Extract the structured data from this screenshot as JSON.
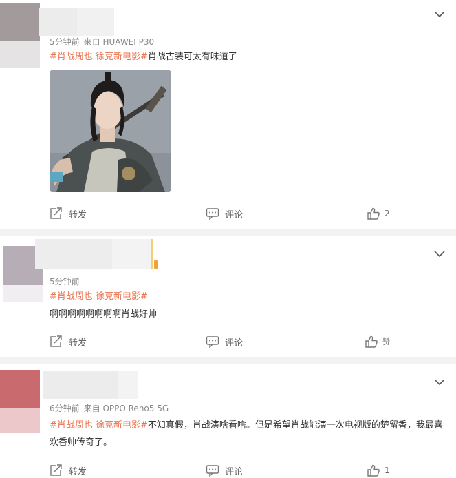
{
  "posts": [
    {
      "time": "5分钟前",
      "source": "来自 HUAWEI P30",
      "topics": "#肖战周也 徐克新电影#",
      "text": "肖战古装可太有味道了",
      "has_photo": true,
      "actions": {
        "repost": "转发",
        "comment": "评论",
        "like": "2"
      }
    },
    {
      "time": "5分钟前",
      "source": "",
      "topics": "#肖战周也 徐克新电影#",
      "text": "啊啊啊啊啊啊啊啊肖战好帅",
      "actions": {
        "repost": "转发",
        "comment": "评论",
        "like": "赞"
      }
    },
    {
      "time": "6分钟前",
      "source": "来自 OPPO Reno5 5G",
      "topics": "#肖战周也 徐克新电影#",
      "text": "不知真假，肖战演啥看啥。但是希望肖战能演一次电视版的楚留香，我最喜欢香帅传奇了。",
      "actions": {
        "repost": "转发",
        "comment": "评论",
        "like": "1"
      }
    }
  ],
  "colors": {
    "topic": "#eb7350",
    "meta": "#888888",
    "separator": "#f2f2f2",
    "avatar1": "#a39a9c",
    "avatar2": "#b6adb6",
    "avatar3": "#c86a6e"
  },
  "icons": [
    "chevron-down-icon",
    "repost-icon",
    "comment-icon",
    "like-icon"
  ]
}
